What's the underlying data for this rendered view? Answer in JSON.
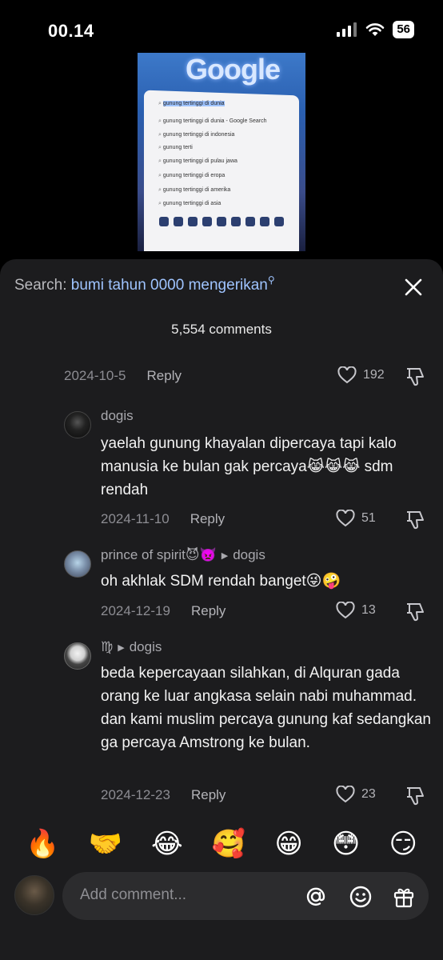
{
  "status": {
    "time": "00.14",
    "battery": "56"
  },
  "video": {
    "title": "Google",
    "suggestions": [
      "gunung tertinggi di dunia",
      "gunung tertinggi di dunia - Google Search",
      "gunung tertinggi di indonesia",
      "gunung terti",
      "gunung tertinggi di pulau jawa",
      "gunung tertinggi di eropa",
      "gunung tertinggi di amerika",
      "gunung tertinggi di asia"
    ]
  },
  "sheet": {
    "search_prefix": "Search:",
    "search_query": "bumi tahun 0000 mengerikan",
    "comment_count": "5,554 comments",
    "reply_label": "Reply"
  },
  "top_meta": {
    "date": "2024-10-5",
    "likes": "192"
  },
  "comments": [
    {
      "user": "dogis",
      "reply_to": "",
      "text": "yaelah gunung khayalan dipercaya tapi kalo manusia ke bulan gak percaya😹😹😹 sdm rendah",
      "date": "2024-11-10",
      "likes": "51"
    },
    {
      "user": "prince of spirit😈👿",
      "reply_to": "dogis",
      "text": "oh akhlak SDM rendah banget😜🤪",
      "date": "2024-12-19",
      "likes": "13"
    },
    {
      "user": "♍",
      "reply_to": "dogis",
      "text": "beda kepercayaan silahkan, di Alquran gada orang ke luar angkasa selain nabi muhammad. dan kami muslim percaya gunung kaf sedangkan ga percaya Amstrong ke bulan.",
      "date": "2024-12-23",
      "likes": "23"
    }
  ],
  "emojis": [
    "🔥",
    "🤝",
    "😂",
    "🥰",
    "😁",
    "😳",
    "😏"
  ],
  "input": {
    "placeholder": "Add comment..."
  },
  "icons": [
    "search-icon",
    "close-icon",
    "heart-icon",
    "dislike-icon",
    "mention-icon",
    "emoji-icon",
    "gift-icon",
    "signal-icon",
    "wifi-icon",
    "battery-icon"
  ]
}
